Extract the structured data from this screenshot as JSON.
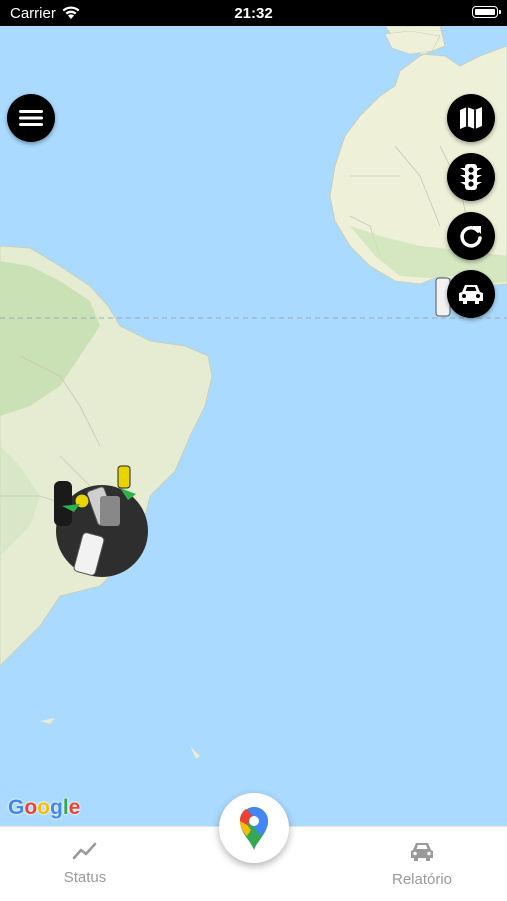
{
  "status_bar": {
    "carrier": "Carrier",
    "time": "21:32"
  },
  "map": {
    "attribution": "Google",
    "ocean_color": "#aadaff",
    "land_color": "#e8ecd5",
    "icons": {
      "menu": "menu-icon",
      "map_type": "map-icon",
      "traffic": "traffic-light-icon",
      "refresh": "refresh-icon",
      "vehicles": "car-icon"
    }
  },
  "bottom_nav": {
    "status_label": "Status",
    "report_label": "Relatório",
    "center_icon": "google-maps-pin-icon"
  }
}
